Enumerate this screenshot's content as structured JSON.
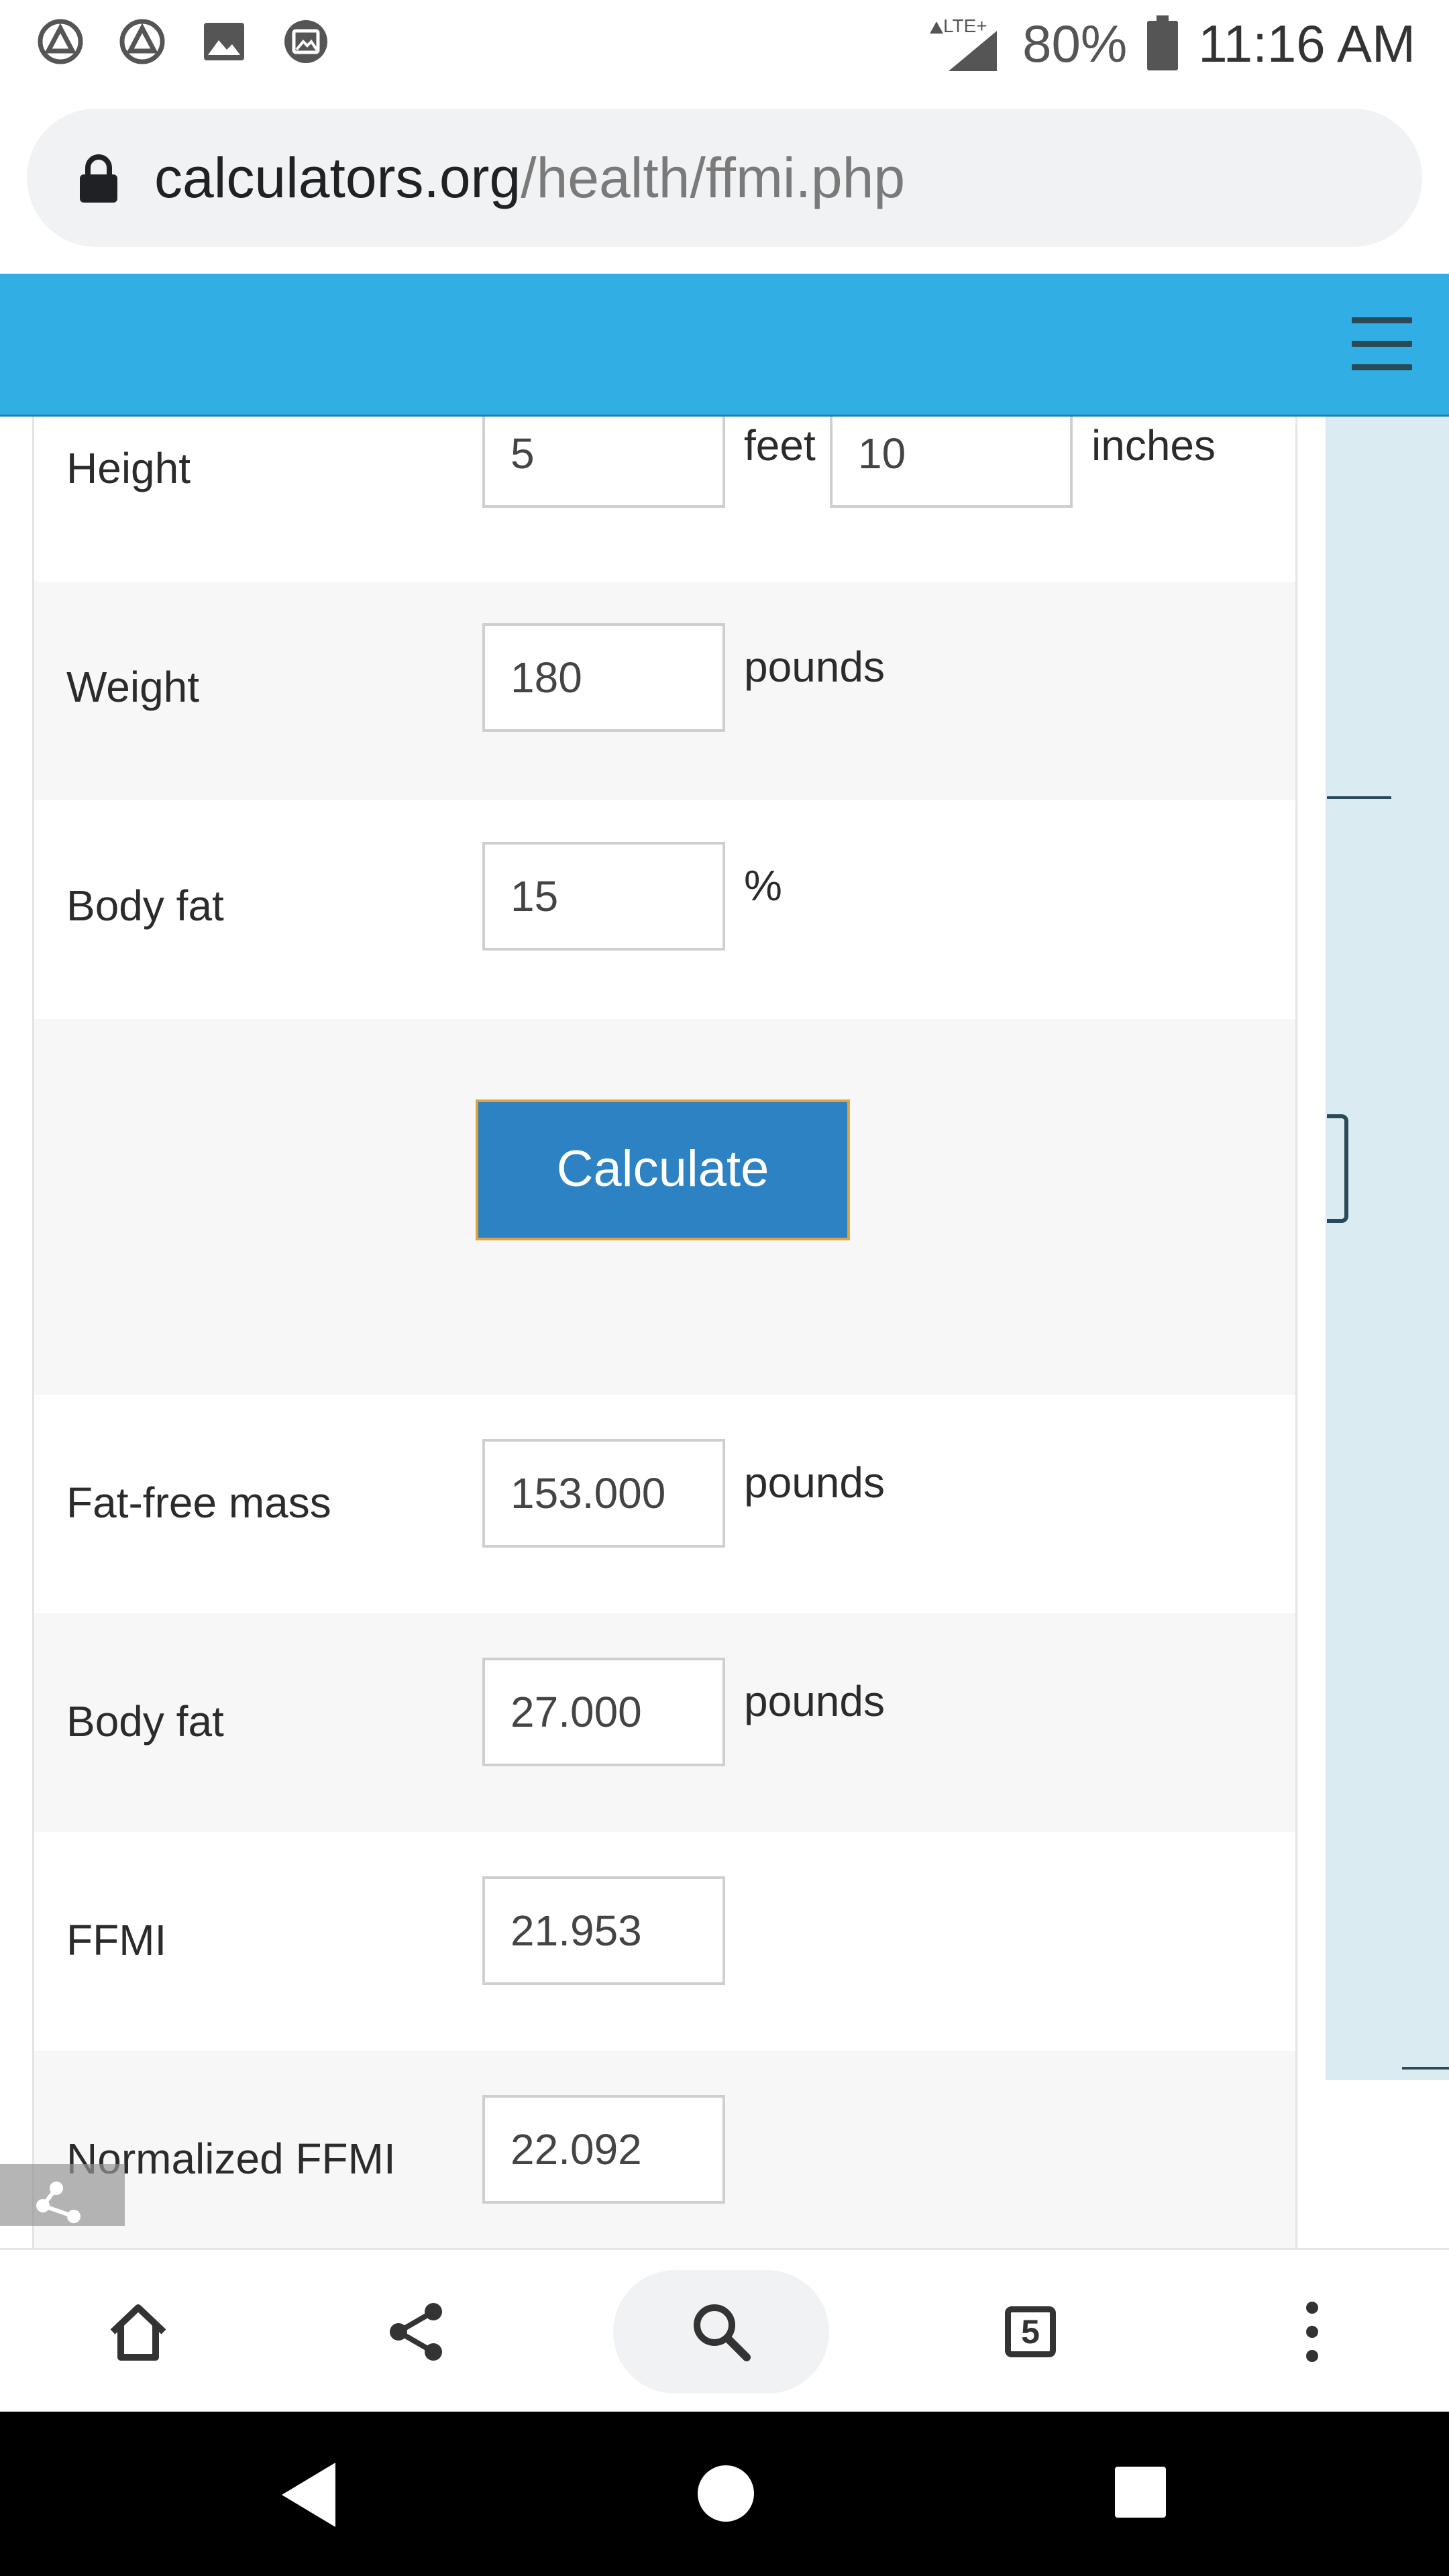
{
  "status_bar": {
    "network": "LTE+",
    "battery": "80%",
    "time": "11:16 AM"
  },
  "browser": {
    "url_domain": "calculators.org",
    "url_path": "/health/ffmi.php",
    "tab_count": "5"
  },
  "form": {
    "height": {
      "label": "Height",
      "feet_value": "5",
      "feet_unit": "feet",
      "inches_value": "10",
      "inches_unit": "inches"
    },
    "weight": {
      "label": "Weight",
      "value": "180",
      "unit": "pounds"
    },
    "body_fat_pct": {
      "label": "Body fat",
      "value": "15",
      "unit": "%"
    },
    "calculate_label": "Calculate"
  },
  "results": {
    "fat_free_mass": {
      "label": "Fat-free mass",
      "value": "153.000",
      "unit": "pounds"
    },
    "body_fat": {
      "label": "Body fat",
      "value": "27.000",
      "unit": "pounds"
    },
    "ffmi": {
      "label": "FFMI",
      "value": "21.953"
    },
    "normalized_ffmi": {
      "label": "Normalized FFMI",
      "value": "22.092"
    }
  },
  "colors": {
    "header": "#31aee4",
    "button": "#2d82c3",
    "button_border": "#e0a43a",
    "side_panel": "#daecf1"
  },
  "icons": [
    "app-notification-icon",
    "image-icon",
    "gallery-icon",
    "signal-icon",
    "battery-icon",
    "lock-icon",
    "hamburger-icon",
    "home-icon",
    "share-icon",
    "search-icon",
    "tabs-icon",
    "more-icon",
    "back-icon",
    "home-nav-icon",
    "recents-icon"
  ]
}
